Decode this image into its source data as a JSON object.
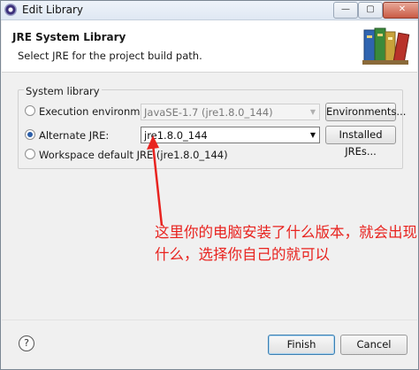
{
  "window": {
    "title": "Edit Library",
    "close_glyph": "✕",
    "minimize_glyph": "—",
    "maximize_glyph": "▢"
  },
  "header": {
    "title": "JRE System Library",
    "description": "Select JRE for the project build path.",
    "icon": "books-icon"
  },
  "group": {
    "label": "System library",
    "options": [
      {
        "label": "Execution environment:",
        "selected": false,
        "combo_value": "JavaSE-1.7 (jre1.8.0_144)",
        "combo_enabled": false,
        "button": "Environments..."
      },
      {
        "label": "Alternate JRE:",
        "selected": true,
        "combo_value": "jre1.8.0_144",
        "combo_enabled": true,
        "button": "Installed JREs..."
      },
      {
        "label": "Workspace default JRE (jre1.8.0_144)",
        "selected": false
      }
    ]
  },
  "annotation": {
    "text": "这里你的电脑安装了什么版本，就会出现什么，选择你自己的就可以",
    "color": "#e8231f"
  },
  "footer": {
    "help_glyph": "?",
    "finish": "Finish",
    "cancel": "Cancel"
  },
  "colors": {
    "accent": "#2b5ea8",
    "annotation": "#e8231f"
  }
}
